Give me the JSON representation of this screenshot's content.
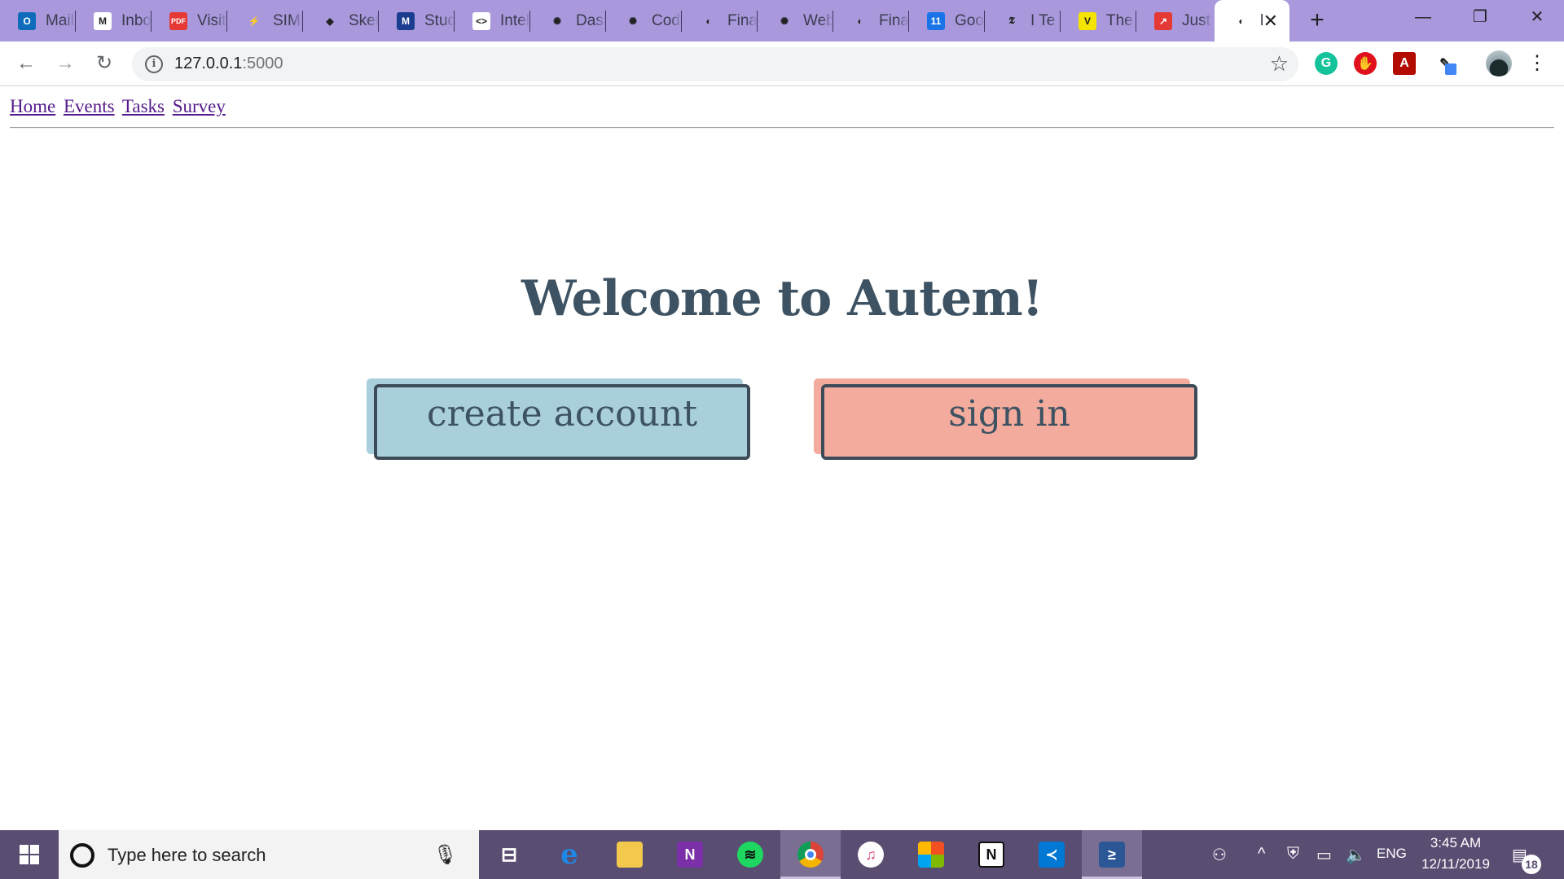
{
  "browser": {
    "tabs": [
      {
        "title": "Mail",
        "icon": "outlook-icon",
        "color": "#0f6cbd",
        "glyph": "O"
      },
      {
        "title": "Inbox",
        "icon": "gmail-icon",
        "color": "#ffffff",
        "glyph": "M"
      },
      {
        "title": "Visit",
        "icon": "pdf-icon",
        "color": "#e53935",
        "glyph": "PDF"
      },
      {
        "title": "SIM",
        "icon": "sim-icon",
        "color": "#a999dc",
        "glyph": "⚡"
      },
      {
        "title": "Sketch",
        "icon": "sketch-icon",
        "color": "#a999dc",
        "glyph": "◆"
      },
      {
        "title": "Studio",
        "icon": "m-icon",
        "color": "#1a3d8f",
        "glyph": "M"
      },
      {
        "title": "Intel",
        "icon": "code-icon",
        "color": "#ffffff",
        "glyph": "<>"
      },
      {
        "title": "Dashboard",
        "icon": "gear-red-icon",
        "color": "#a999dc",
        "glyph": "✺"
      },
      {
        "title": "Code",
        "icon": "gear-red-icon",
        "color": "#a999dc",
        "glyph": "✺"
      },
      {
        "title": "Final",
        "icon": "globe-icon",
        "color": "#a999dc",
        "glyph": "◐"
      },
      {
        "title": "Web",
        "icon": "gear-red-icon",
        "color": "#a999dc",
        "glyph": "✺"
      },
      {
        "title": "Final",
        "icon": "globe-icon",
        "color": "#a999dc",
        "glyph": "◐"
      },
      {
        "title": "Google",
        "icon": "calendar-icon",
        "color": "#1a73e8",
        "glyph": "11"
      },
      {
        "title": "I Te",
        "icon": "nyt-icon",
        "color": "#a999dc",
        "glyph": "𝕿"
      },
      {
        "title": "The",
        "icon": "v-icon",
        "color": "#f5e400",
        "glyph": "V"
      },
      {
        "title": "Just",
        "icon": "trend-icon",
        "color": "#e53935",
        "glyph": "↗"
      },
      {
        "title": "l",
        "icon": "globe-icon",
        "color": "#ffffff",
        "glyph": "◐",
        "active": true
      }
    ],
    "new_tab_label": "+",
    "window": {
      "minimize": "—",
      "restore": "❐",
      "close": "✕"
    },
    "address": {
      "host": "127.0.0.1",
      "port": ":5000"
    },
    "nav": {
      "back": "←",
      "forward": "→",
      "reload": "↻"
    },
    "star": "☆",
    "menu": "⋮"
  },
  "page": {
    "nav_links": [
      "Home",
      "Events",
      "Tasks",
      "Survey"
    ],
    "heading": "Welcome to Autem!",
    "create_account_label": "create account",
    "sign_in_label": "sign in",
    "colors": {
      "create_fill": "#a9cfdc",
      "sign_in_fill": "#f2ab9c",
      "text": "#3d5262",
      "border": "#3d4b58"
    }
  },
  "taskbar": {
    "search_placeholder": "Type here to search",
    "apps": [
      "task-view",
      "edge",
      "file-explorer",
      "onenote",
      "spotify",
      "chrome",
      "itunes",
      "store",
      "notion",
      "vscode",
      "powershell"
    ],
    "language": "ENG",
    "time": "3:45 AM",
    "date": "12/11/2019",
    "notification_count": "18"
  }
}
